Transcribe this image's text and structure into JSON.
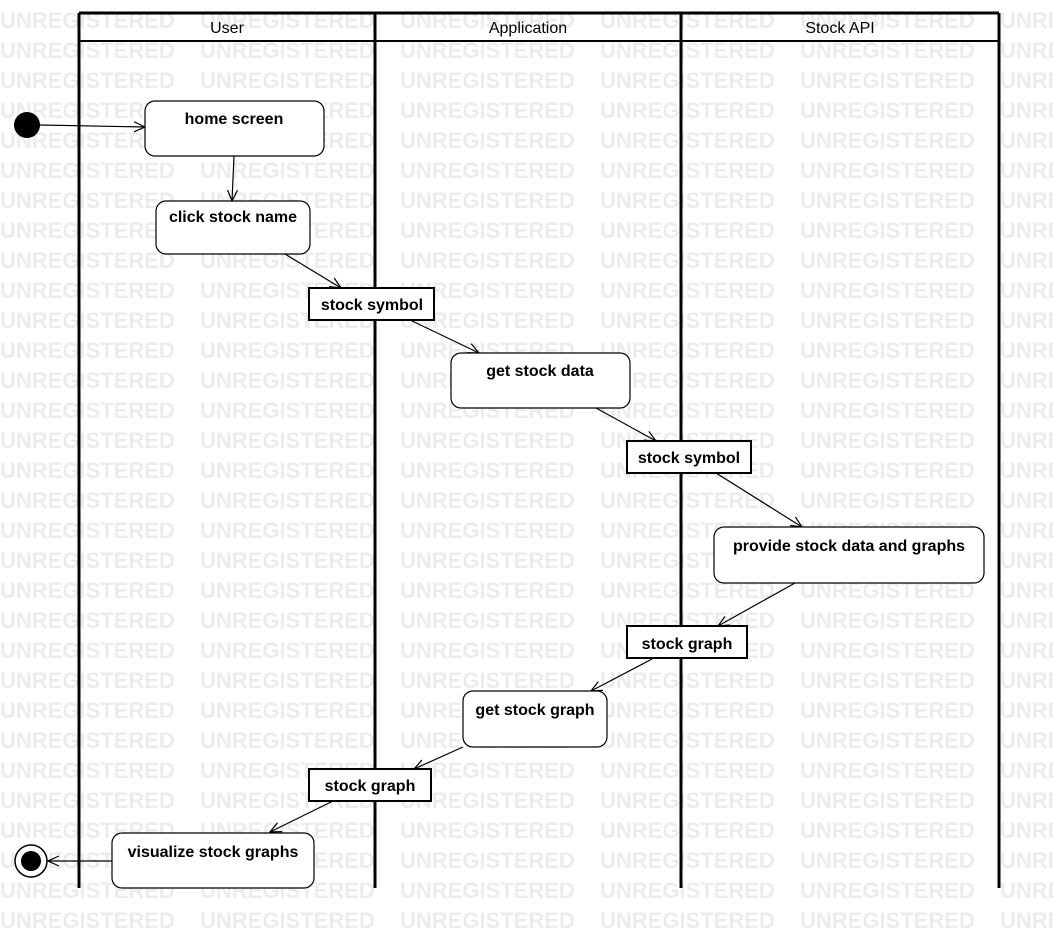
{
  "watermark_text": "UNREGISTERED",
  "lanes": [
    {
      "id": "user",
      "title": "User"
    },
    {
      "id": "app",
      "title": "Application"
    },
    {
      "id": "api",
      "title": "Stock API"
    }
  ],
  "actions": [
    {
      "id": "home",
      "label": "home screen"
    },
    {
      "id": "click",
      "label": "click stock name"
    },
    {
      "id": "getdata",
      "label": "get stock data"
    },
    {
      "id": "provide",
      "label": "provide stock data and graphs"
    },
    {
      "id": "getgraph",
      "label": "get stock graph"
    },
    {
      "id": "visualize",
      "label": "visualize stock graphs"
    }
  ],
  "objects": [
    {
      "id": "sym1",
      "label": "stock symbol"
    },
    {
      "id": "sym2",
      "label": "stock symbol"
    },
    {
      "id": "graph1",
      "label": "stock graph"
    },
    {
      "id": "graph2",
      "label": "stock graph"
    }
  ],
  "flows": [
    [
      "start",
      "home"
    ],
    [
      "home",
      "click"
    ],
    [
      "click",
      "sym1"
    ],
    [
      "sym1",
      "getdata"
    ],
    [
      "getdata",
      "sym2"
    ],
    [
      "sym2",
      "provide"
    ],
    [
      "provide",
      "graph1"
    ],
    [
      "graph1",
      "getgraph"
    ],
    [
      "getgraph",
      "graph2"
    ],
    [
      "graph2",
      "visualize"
    ],
    [
      "visualize",
      "end"
    ]
  ]
}
